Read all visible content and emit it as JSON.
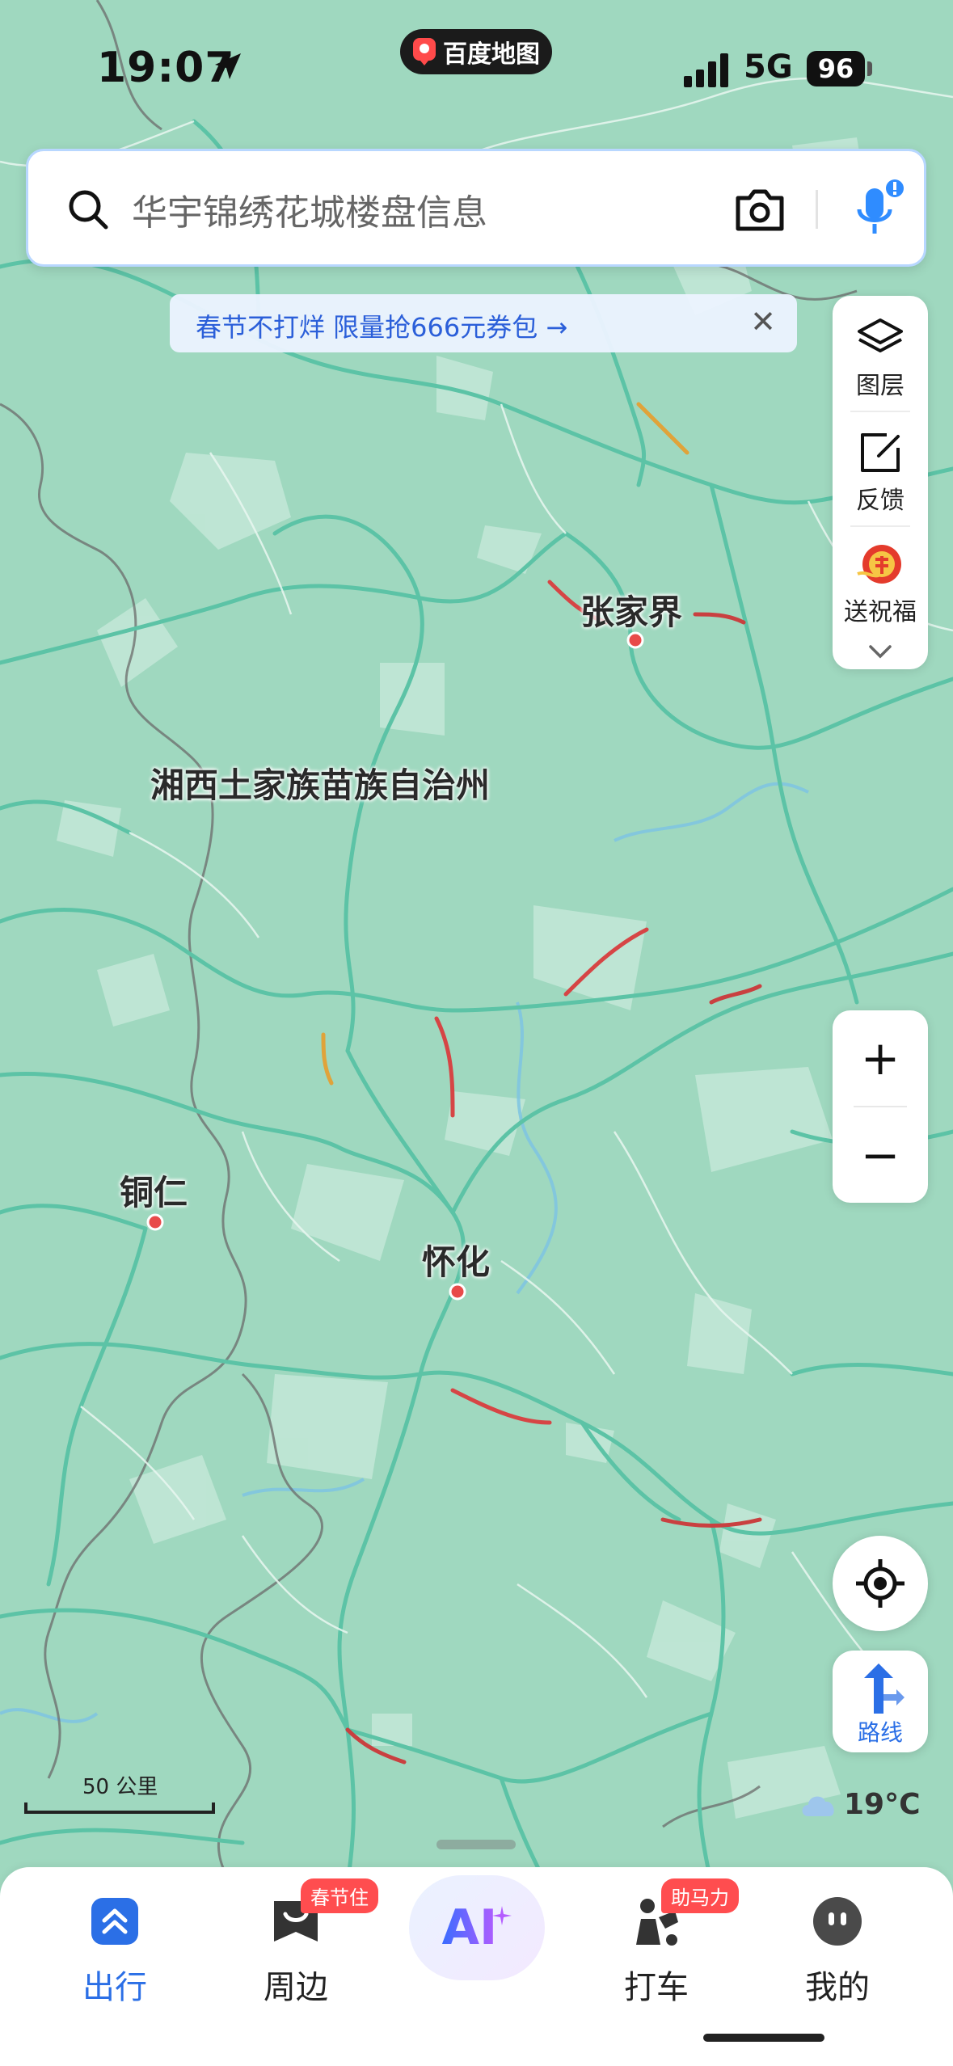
{
  "status_bar": {
    "time": "19:07",
    "app_name": "百度地图",
    "network": "5G",
    "battery": "96"
  },
  "search": {
    "placeholder": "华宇锦绣花城楼盘信息"
  },
  "promo": {
    "text": "春节不打烊 限量抢666元券包 →",
    "close": "✕"
  },
  "right_panel": {
    "layers_label": "图层",
    "feedback_label": "反馈",
    "greeting_label": "送祝福"
  },
  "zoom": {
    "plus": "+",
    "minus": "−"
  },
  "route": {
    "label": "路线"
  },
  "weather": {
    "temp": "19°C"
  },
  "scale": {
    "label": "50 公里"
  },
  "map_labels": {
    "zhangjiajie": "张家界",
    "xiangxi": "湘西土家族苗族自治州",
    "tongren": "铜仁",
    "huaihua": "怀化"
  },
  "tabs": [
    {
      "label": "出行",
      "badge": ""
    },
    {
      "label": "周边",
      "badge": "春节住"
    },
    {
      "label": "AI",
      "badge": ""
    },
    {
      "label": "打车",
      "badge": "助马力"
    },
    {
      "label": "我的",
      "badge": ""
    }
  ],
  "colors": {
    "map_base": "#9fd8bf",
    "road": "#5cc3a6",
    "accent": "#2b6fe6",
    "badge": "#ff4d4f"
  }
}
